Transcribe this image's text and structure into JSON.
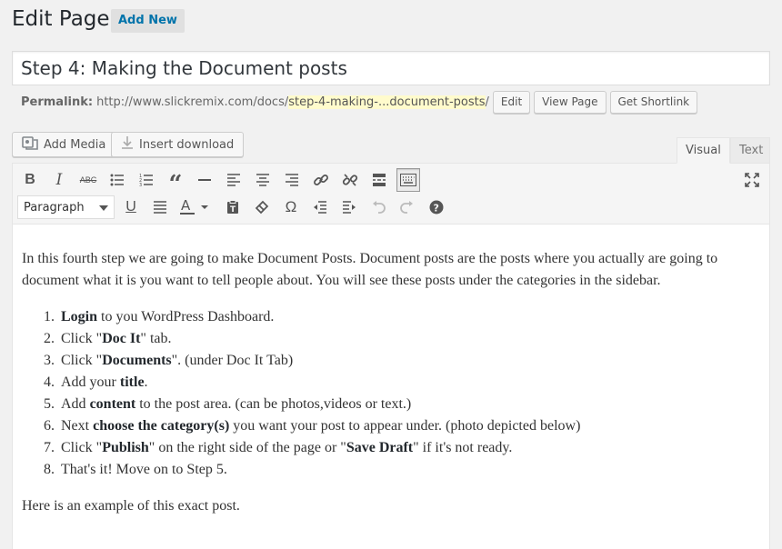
{
  "header": {
    "title": "Edit Page",
    "add_new": "Add New"
  },
  "post_title": "Step 4: Making the Document posts",
  "permalink": {
    "label": "Permalink:",
    "base": "http://www.slickremix.com/docs/",
    "slug": "step-4-making-...document-posts",
    "trail": "/",
    "buttons": {
      "edit": "Edit",
      "view": "View Page",
      "shortlink": "Get Shortlink"
    }
  },
  "media": {
    "add_media": "Add Media",
    "insert_download": "Insert download"
  },
  "tabs": {
    "visual": "Visual",
    "text": "Text"
  },
  "toolbar": {
    "format": "Paragraph",
    "row1": [
      "bold-icon",
      "italic-icon",
      "strikethrough-icon",
      "bullet-list-icon",
      "numbered-list-icon",
      "blockquote-icon",
      "horizontal-line-icon",
      "align-left-icon",
      "align-center-icon",
      "align-right-icon",
      "link-icon",
      "unlink-icon",
      "read-more-icon",
      "toolbar-toggle-icon",
      "fullscreen-icon"
    ],
    "row2": [
      "underline-icon",
      "justify-icon",
      "text-color-icon",
      "paste-text-icon",
      "clear-formatting-icon",
      "special-character-icon",
      "outdent-icon",
      "indent-icon",
      "undo-icon",
      "redo-icon",
      "help-icon"
    ]
  },
  "content": {
    "intro": "In this fourth step we are going to make Document Posts. Document posts are the posts where you actually are going to document what it is you want to tell people about. You will see these posts under the categories in the sidebar.",
    "steps": [
      {
        "bold": "Login",
        "after": " to you WordPress Dashboard."
      },
      {
        "before": "Click \"",
        "bold": "Doc It",
        "after": "\" tab."
      },
      {
        "before": "Click \"",
        "bold": "Documents",
        "after": "\". (under Doc It Tab)"
      },
      {
        "before": "Add your ",
        "bold": "title",
        "after": "."
      },
      {
        "before": "Add ",
        "bold": "content",
        "after": " to the post area. (can be photos,videos or text.)"
      },
      {
        "before": "Next ",
        "bold": "choose the category(s)",
        "after": " you want your post to appear under. (photo depicted below)"
      },
      {
        "before": "Click \"",
        "bold": "Publish",
        "mid": "\" on the right side of the page or \"",
        "bold2": "Save Draft",
        "after": "\" if it's not ready."
      },
      {
        "before": "That's it! Move on to Step 5."
      }
    ],
    "outro": "Here is an example of this exact post."
  }
}
